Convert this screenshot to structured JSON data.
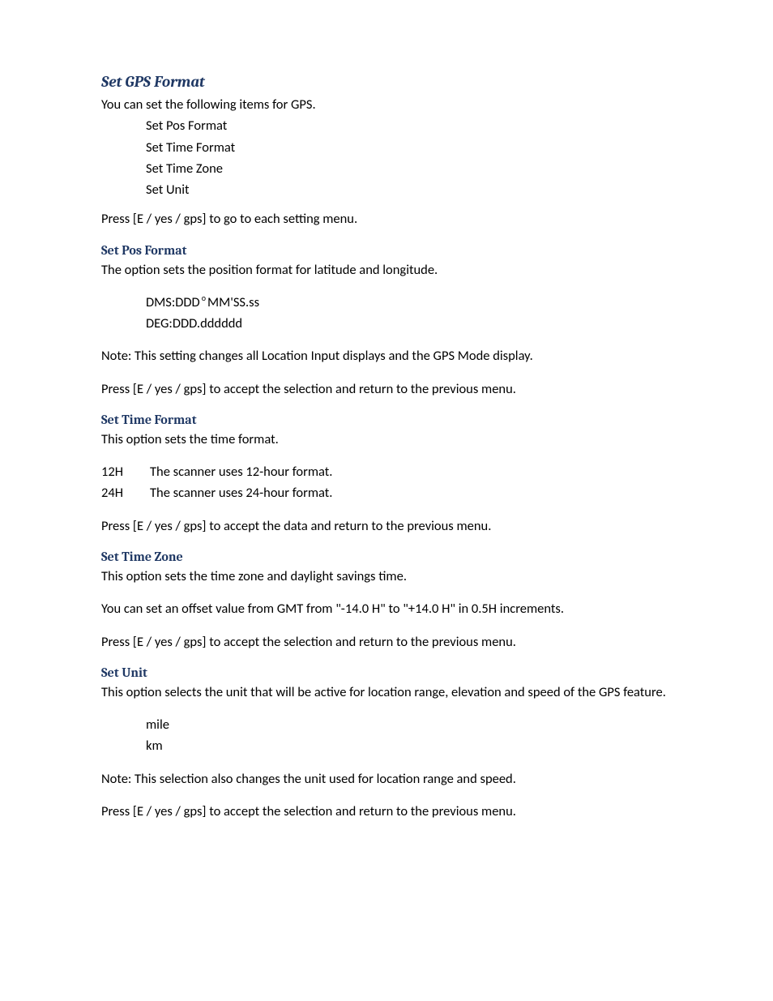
{
  "title": "Set GPS Format",
  "intro": {
    "lead": "You can set the following items for GPS.",
    "items": [
      "Set Pos Format",
      "Set Time Format",
      "Set Time Zone",
      "Set Unit"
    ],
    "press": "Press [E / yes / gps] to go to each setting menu."
  },
  "pos": {
    "heading": "Set Pos Format",
    "desc": "The option sets the position format for latitude and longitude.",
    "dms_pre": "DMS:DDD",
    "dms_sup": "o",
    "dms_post": "MM'SS.ss",
    "deg": "DEG:DDD.dddddd",
    "note": "Note: This setting changes all Location Input displays and the GPS Mode display.",
    "press": "Press [E / yes / gps] to accept the selection and return to the previous menu."
  },
  "time": {
    "heading": "Set Time Format",
    "desc": "This option sets the time format.",
    "row12_key": "12H",
    "row12_val": "The scanner uses 12-hour format.",
    "row24_key": "24H",
    "row24_val": "The scanner uses 24-hour format.",
    "press": "Press [E / yes / gps] to accept the data and return to the previous menu."
  },
  "zone": {
    "heading": "Set Time Zone",
    "desc": "This option sets the time zone and daylight savings time.",
    "offset": "You can set an offset value from GMT from \"-14.0 H\" to \"+14.0 H\" in 0.5H increments.",
    "press": "Press [E / yes / gps] to accept the selection  and return to the previous menu."
  },
  "unit": {
    "heading": "Set Unit",
    "desc": "This option selects the unit that will be active for location range, elevation and speed of the GPS feature.",
    "u1": "mile",
    "u2": "km",
    "note": "Note:  This selection also changes the unit used for location range and speed.",
    "press": "Press [E / yes / gps] to accept the selection and return to the previous menu."
  }
}
